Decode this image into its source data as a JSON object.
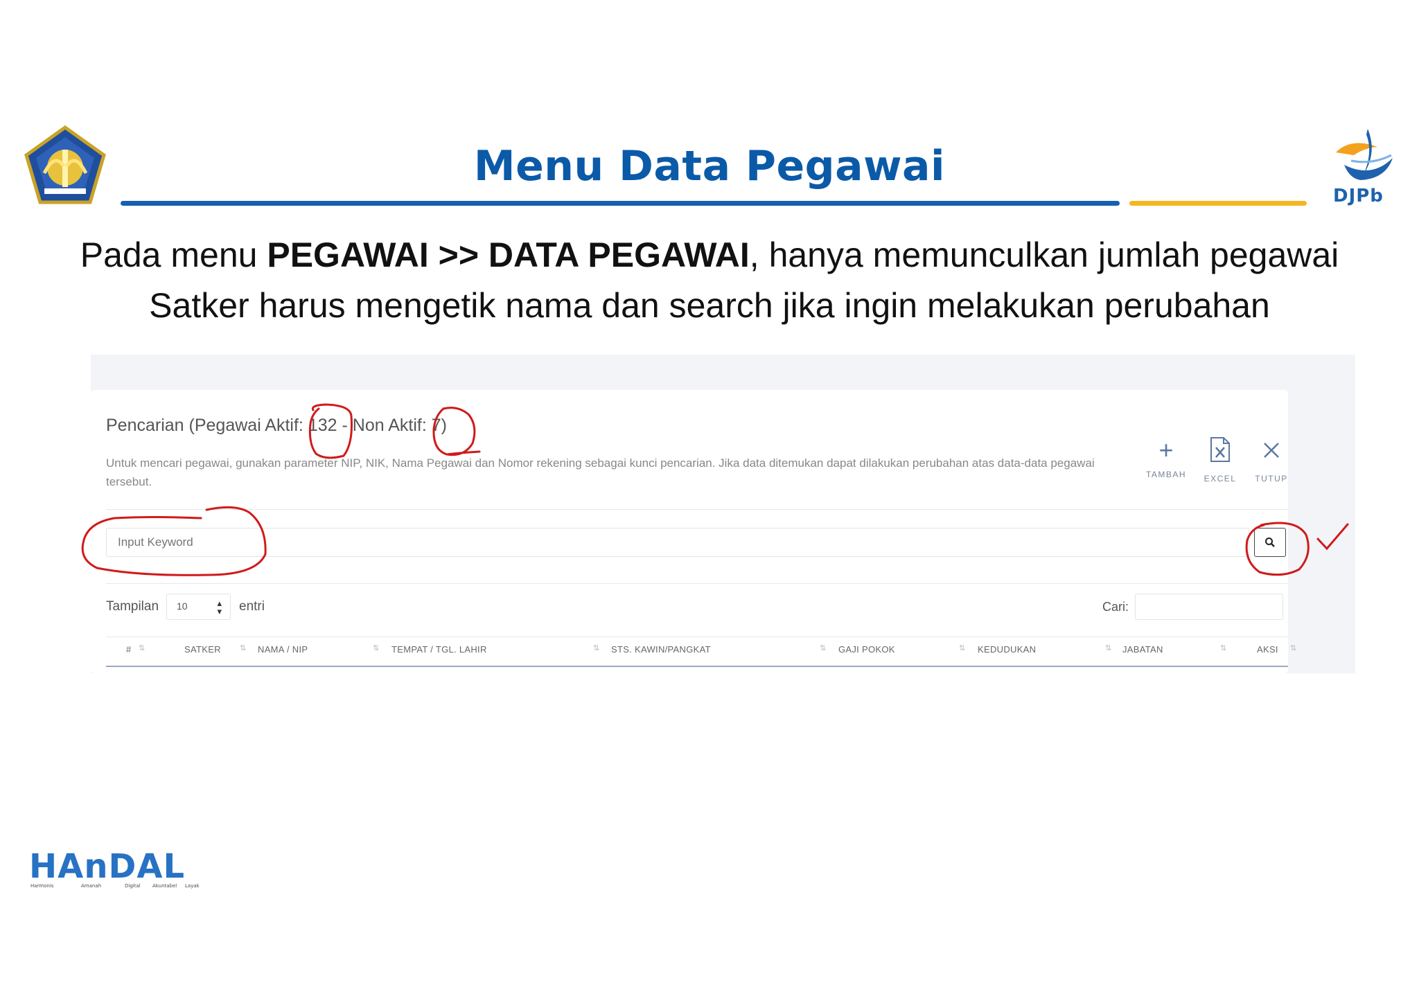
{
  "slide": {
    "title": "Menu Data Pegawai",
    "line1": {
      "pre": "Pada menu ",
      "bold": "PEGAWAI >> DATA PEGAWAI",
      "post": ", hanya memunculkan jumlah pegawai"
    },
    "line2": "Satker harus mengetik nama dan search jika ingin melakukan perubahan",
    "logo_right_text": "DJPb",
    "logo_bottom_text": "HAnDAL",
    "logo_bottom_tagline": [
      "Harmonis",
      "Amanah",
      "Digital",
      "Akuntabel",
      "Layak"
    ],
    "colors": {
      "title": "#0b5aa8",
      "rule_blue": "#1560b0",
      "rule_gold": "#f4b623",
      "annotation": "#d01a1a"
    }
  },
  "screen": {
    "heading": {
      "pre": "Pencarian (Pegawai Aktif: ",
      "aktif": "132",
      "mid": " - Non Aktif: ",
      "nonaktif": "7",
      "post": ")"
    },
    "description": "Untuk mencari pegawai, gunakan parameter NIP, NIK, Nama Pegawai dan Nomor rekening sebagai kunci pencarian. Jika data ditemukan dapat dilakukan perubahan atas data-data pegawai tersebut.",
    "toolbar": [
      {
        "label": "TAMBAH",
        "icon": "plus-icon"
      },
      {
        "label": "EXCEL",
        "icon": "excel-file-icon"
      },
      {
        "label": "TUTUP",
        "icon": "close-icon"
      }
    ],
    "search": {
      "placeholder": "Input Keyword",
      "button_icon": "search-icon"
    },
    "length": {
      "label": "Tampilan",
      "value": "10",
      "suffix": "entri"
    },
    "filter": {
      "label": "Cari:",
      "value": ""
    },
    "columns": [
      "#",
      "SATKER",
      "NAMA / NIP",
      "TEMPAT / TGL. LAHIR",
      "STS. KAWIN/PANGKAT",
      "GAJI POKOK",
      "KEDUDUKAN",
      "JABATAN",
      "AKSI"
    ]
  }
}
